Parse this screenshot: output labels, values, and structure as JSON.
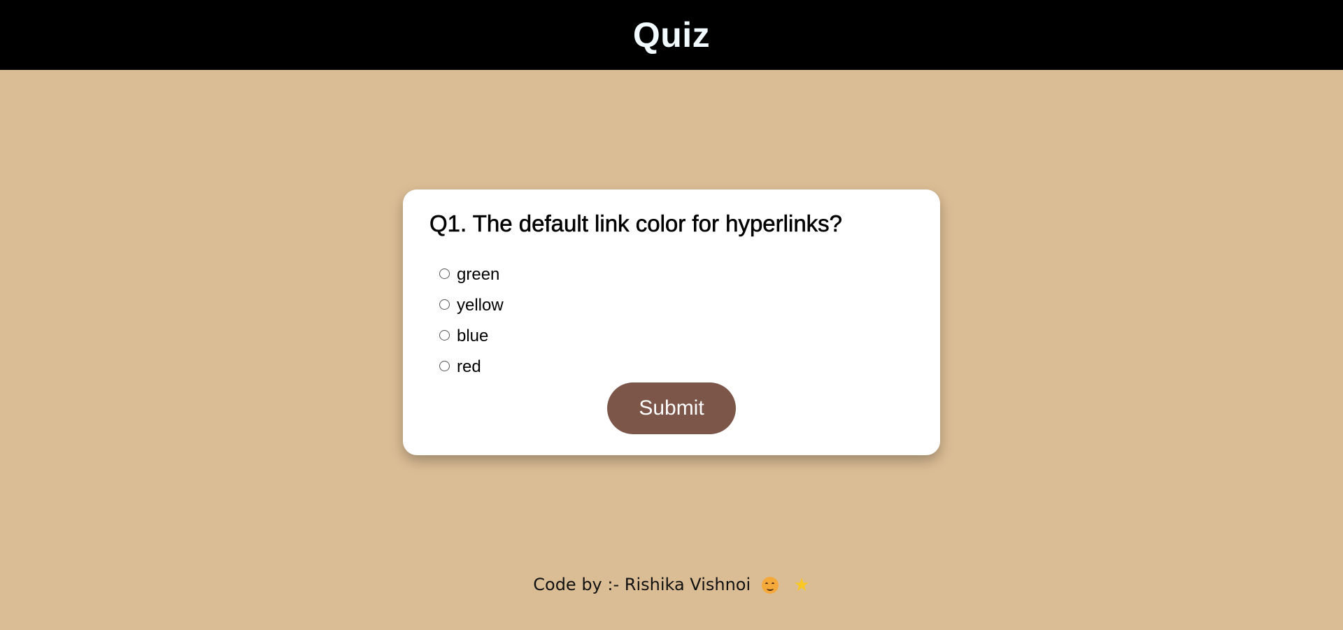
{
  "header": {
    "title": "Quiz"
  },
  "quiz": {
    "question": "Q1. The default link color for hyperlinks?",
    "options": [
      {
        "label": "green",
        "selected": false
      },
      {
        "label": "yellow",
        "selected": false
      },
      {
        "label": "blue",
        "selected": false
      },
      {
        "label": "red",
        "selected": false
      }
    ],
    "submit_label": "Submit"
  },
  "footer": {
    "text": "Code by :- Rishika Vishnoi",
    "icons": [
      "smiling-face-icon",
      "star-icon"
    ]
  },
  "colors": {
    "page_background": "#dbbd95",
    "header_background": "#000000",
    "header_text": "#f2fbff",
    "card_background": "#ffffff",
    "submit_button": "#7b5649",
    "submit_text": "#ffffff",
    "star": "#f9c822",
    "smile": "#f6a93b"
  }
}
